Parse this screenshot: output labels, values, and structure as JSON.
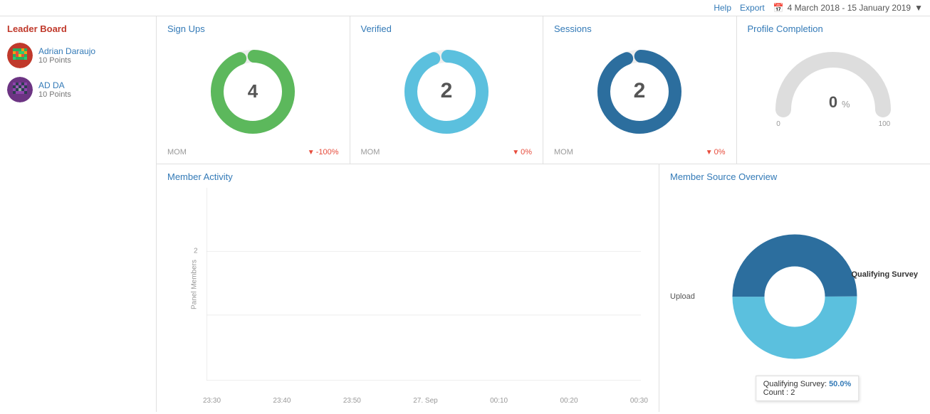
{
  "topbar": {
    "help_label": "Help",
    "export_label": "Export",
    "date_range": "4 March 2018 - 15 January 2019"
  },
  "leaderboard": {
    "title": "Leader Board",
    "members": [
      {
        "name": "Adrian Daraujo",
        "points": "10 Points",
        "avatar_color1": "#c0392b",
        "avatar_color2": "#e74c3c"
      },
      {
        "name": "AD DA",
        "points": "10 Points",
        "avatar_color1": "#6c3483",
        "avatar_color2": "#8e44ad"
      }
    ]
  },
  "signups": {
    "title": "Sign Ups",
    "value": "4",
    "mom_label": "MOM",
    "change": "-100%",
    "color": "#5cb85c"
  },
  "verified": {
    "title": "Verified",
    "value": "2",
    "mom_label": "MOM",
    "change": "0%",
    "color": "#5bc0de"
  },
  "sessions": {
    "title": "Sessions",
    "value": "2",
    "mom_label": "MOM",
    "change": "0%",
    "color": "#2c6e9e"
  },
  "profile_completion": {
    "title": "Profile Completion",
    "value": "0",
    "percent": "%",
    "min_label": "0",
    "max_label": "100"
  },
  "member_activity": {
    "title": "Member Activity",
    "y_axis_label": "Panel Members",
    "x_labels": [
      "23:30",
      "23:40",
      "23:50",
      "27. Sep",
      "00:10",
      "00:20",
      "00:30"
    ],
    "y_labels": [
      "2",
      ""
    ]
  },
  "member_source": {
    "title": "Member Source Overview",
    "segments": [
      {
        "label": "Upload",
        "color": "#5bc0de",
        "percent": 50
      },
      {
        "label": "Qualifying Survey",
        "color": "#2c6e9e",
        "percent": 50
      }
    ],
    "tooltip": {
      "title": "Qualifying Survey:",
      "percent": "50.0%",
      "count_label": "Count :",
      "count_value": "2"
    }
  }
}
